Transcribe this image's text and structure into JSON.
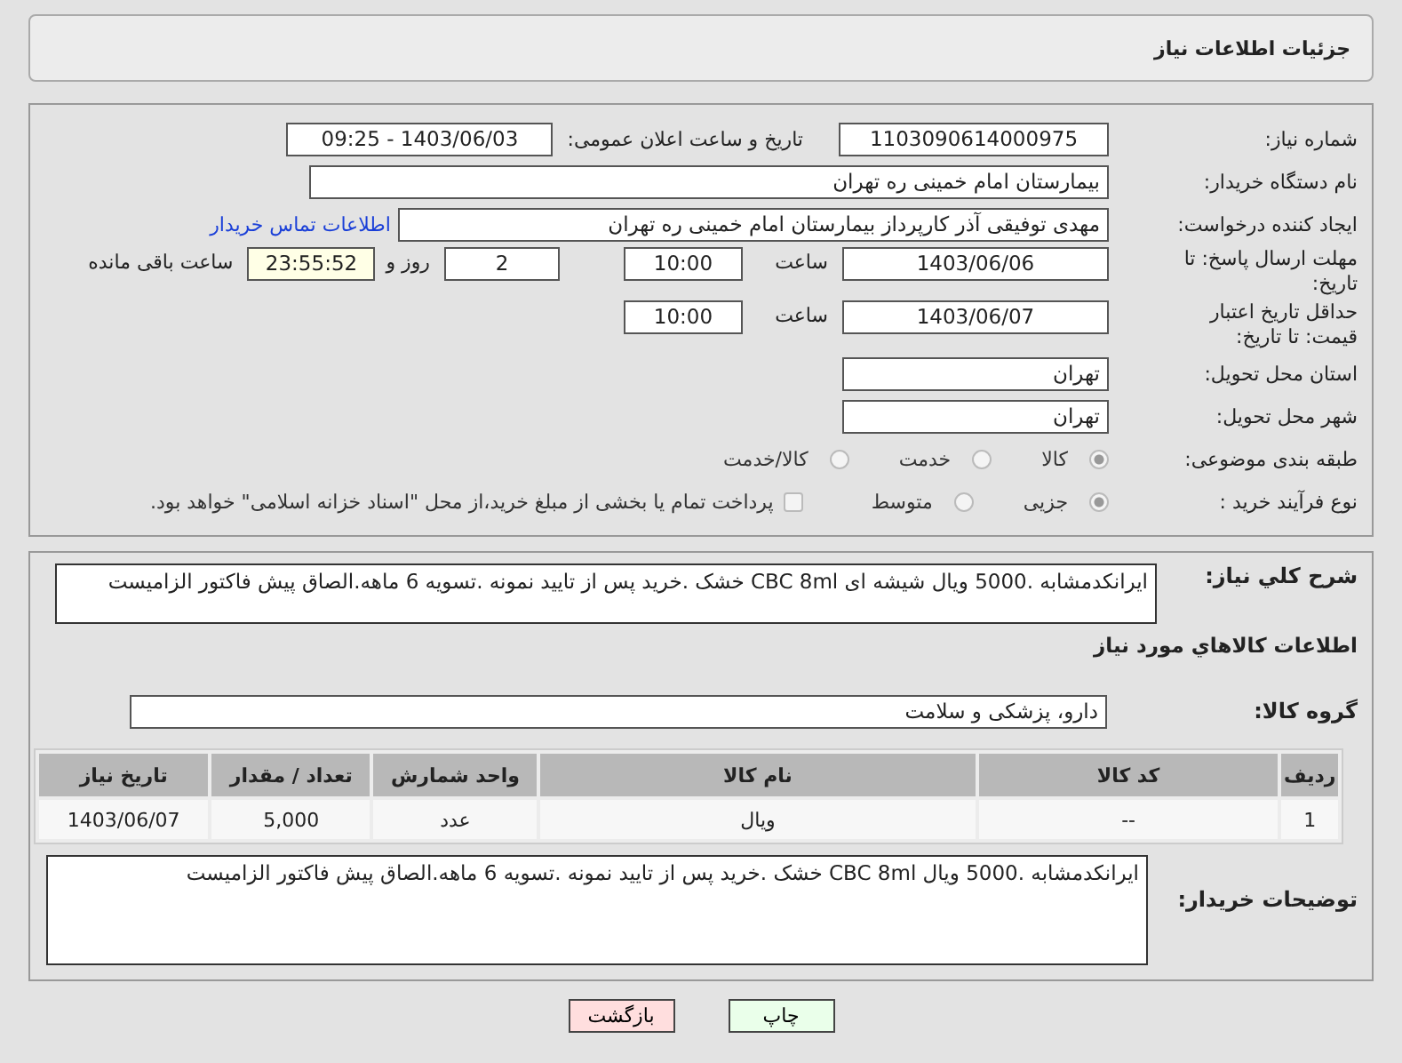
{
  "header": {
    "title": "جزئیات اطلاعات نیاز"
  },
  "need_number": {
    "label": "شماره نیاز:",
    "value": "1103090614000975"
  },
  "announce": {
    "label": "تاریخ و ساعت اعلان عمومی:",
    "value": "1403/06/03 - 09:25"
  },
  "buyer_org": {
    "label": "نام دستگاه خریدار:",
    "value": "بیمارستان امام خمینی ره  تهران"
  },
  "requester": {
    "label": "ایجاد کننده درخواست:",
    "value": "مهدی توفیقی آذر کارپرداز بیمارستان امام خمینی ره  تهران",
    "link": "اطلاعات تماس خریدار"
  },
  "deadline": {
    "label": "مهلت ارسال پاسخ: تا تاریخ:",
    "date": "1403/06/06",
    "time_label": "ساعت",
    "time": "10:00",
    "days": "2",
    "days_label": "روز و",
    "remaining": "23:55:52",
    "remaining_label": "ساعت باقی مانده"
  },
  "validity": {
    "label": "حداقل تاریخ اعتبار قیمت: تا تاریخ:",
    "date": "1403/06/07",
    "time_label": "ساعت",
    "time": "10:00"
  },
  "province": {
    "label": "استان محل تحویل:",
    "value": "تهران"
  },
  "city": {
    "label": "شهر محل تحویل:",
    "value": "تهران"
  },
  "category": {
    "label": "طبقه بندی موضوعی:",
    "options": [
      {
        "label": "کالا",
        "selected": true
      },
      {
        "label": "خدمت",
        "selected": false
      },
      {
        "label": "کالا/خدمت",
        "selected": false
      }
    ]
  },
  "process": {
    "label": "نوع فرآیند خرید :",
    "options": [
      {
        "label": "جزیی",
        "selected": true
      },
      {
        "label": "متوسط",
        "selected": false
      }
    ],
    "treasury": {
      "label": "پرداخت تمام یا بخشی از مبلغ خرید،از محل \"اسناد خزانه اسلامی\" خواهد بود.",
      "checked": false
    }
  },
  "description": {
    "label": "شرح کلي نياز:",
    "value": "ایرانکدمشابه .5000 ویال شیشه ای CBC 8ml خشک .خرید پس از تایید نمونه .تسویه 6 ماهه.الصاق پیش فاکتور الزامیست"
  },
  "goods_title": "اطلاعات کالاهاي مورد نياز",
  "group": {
    "label": "گروه کالا:",
    "value": "دارو، پزشکی و سلامت"
  },
  "table": {
    "columns": [
      "ردیف",
      "کد کالا",
      "نام کالا",
      "واحد شمارش",
      "تعداد / مقدار",
      "تاریخ نیاز"
    ],
    "rows": [
      [
        "1",
        "--",
        "ویال",
        "عدد",
        "5,000",
        "1403/06/07"
      ]
    ]
  },
  "buyer_notes": {
    "label": "توضیحات خریدار:",
    "value": "ایرانکدمشابه .5000 ویال CBC 8ml خشک .خرید پس از تایید نمونه .تسویه 6 ماهه.الصاق پیش فاکتور الزامیست"
  },
  "buttons": [
    {
      "label": "چاپ",
      "kind": "print"
    },
    {
      "label": "بازگشت",
      "kind": "back"
    }
  ]
}
